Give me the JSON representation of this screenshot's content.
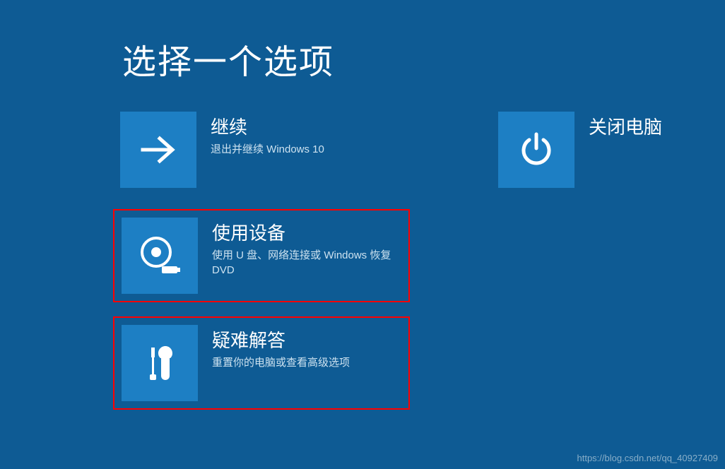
{
  "title": "选择一个选项",
  "options": {
    "continue": {
      "title": "继续",
      "subtitle": "退出并继续 Windows 10"
    },
    "shutdown": {
      "title": "关闭电脑",
      "subtitle": ""
    },
    "useDevice": {
      "title": "使用设备",
      "subtitle": "使用 U 盘、网络连接或 Windows 恢复 DVD"
    },
    "troubleshoot": {
      "title": "疑难解答",
      "subtitle": "重置你的电脑或查看高级选项"
    }
  },
  "watermark": "https://blog.csdn.net/qq_40927409"
}
